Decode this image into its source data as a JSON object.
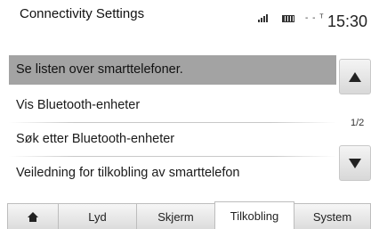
{
  "header": {
    "title": "Connectivity Settings",
    "network_text": "- - ᵀ",
    "clock": "15:30"
  },
  "menu": {
    "items": [
      {
        "label": "Se listen over smarttelefoner.",
        "selected": true
      },
      {
        "label": "Vis Bluetooth-enheter",
        "selected": false
      },
      {
        "label": "Søk etter Bluetooth-enheter",
        "selected": false
      },
      {
        "label": "Veiledning for tilkobling av smarttelefon",
        "selected": false
      }
    ],
    "page_indicator": "1/2"
  },
  "icons": {
    "signal": "signal-strength-icon",
    "battery": "battery-icon",
    "home": "home-icon",
    "scroll_up": "arrow-up-icon",
    "scroll_down": "arrow-down-icon"
  },
  "tabs": [
    {
      "label": "",
      "icon": "home-icon",
      "active": false
    },
    {
      "label": "Lyd",
      "active": false
    },
    {
      "label": "Skjerm",
      "active": false
    },
    {
      "label": "Tilkobling",
      "active": true
    },
    {
      "label": "System",
      "active": false
    }
  ],
  "colors": {
    "selected_row": "#a3a3a3",
    "active_tab": "#ffffff",
    "inactive_tab": "#e4e4e4"
  }
}
